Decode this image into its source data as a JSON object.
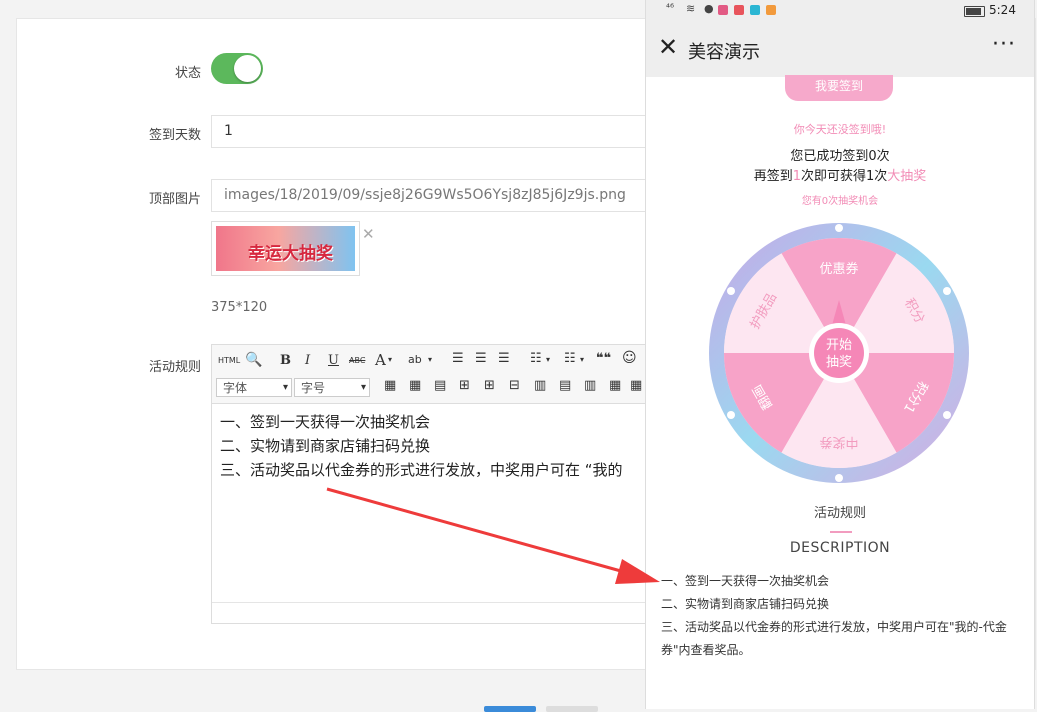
{
  "form": {
    "status_label": "状态",
    "days_label": "签到天数",
    "days_value": "1",
    "image_label": "顶部图片",
    "image_path": "images/18/2019/09/ssje8j26G9Ws5O6Ysj8zJ85j6Jz9js.png",
    "thumb_text": "幸运大抽奖",
    "image_size_hint": "375*120",
    "rules_label": "活动规则"
  },
  "editor": {
    "toolbar": {
      "html_label": "HTML",
      "bold": "B",
      "italic": "I",
      "underline": "U",
      "strike": "ABC",
      "font_color": "A",
      "highlight": "ab",
      "quote": "❝❝",
      "font_select": "字体",
      "size_select": "字号"
    },
    "content": [
      "一、签到一天获得一次抽奖机会",
      "二、实物请到商家店铺扫码兑换",
      "三、活动奖品以代金券的形式进行发放，中奖用户可在 “我的"
    ]
  },
  "phone": {
    "statusbar": {
      "signal": "⁴⁶",
      "time": "5:24"
    },
    "nav": {
      "close_glyph": "✕",
      "title": "美容演示",
      "more_glyph": "···"
    },
    "signin_button": "我要签到",
    "not_signed": "你今天还没签到哦!",
    "signed_count": "您已成功签到0次",
    "next_prefix": "再签到",
    "next_days": "1",
    "next_mid": "次即可获得1次",
    "next_prize": "大抽奖",
    "chances": "您有0次抽奖机会",
    "wheel": {
      "center_label_1": "开始",
      "center_label_2": "抽奖",
      "segments": [
        "优惠券",
        "积分",
        "积分1",
        "中奖券",
        "翻画",
        "护肤品"
      ]
    },
    "rules_title": "活动规则",
    "desc_title": "DESCRIPTION",
    "rules": [
      "一、签到一天获得一次抽奖机会",
      "二、实物请到商家店铺扫码兑换",
      "三、活动奖品以代金券的形式进行发放，中奖用户可在\"我的-代金券\"内查看奖品。"
    ]
  },
  "colors": {
    "toggle_on": "#5cb85c",
    "pink_accent": "#f28cb6",
    "arrow_red": "#ee3b3b"
  }
}
